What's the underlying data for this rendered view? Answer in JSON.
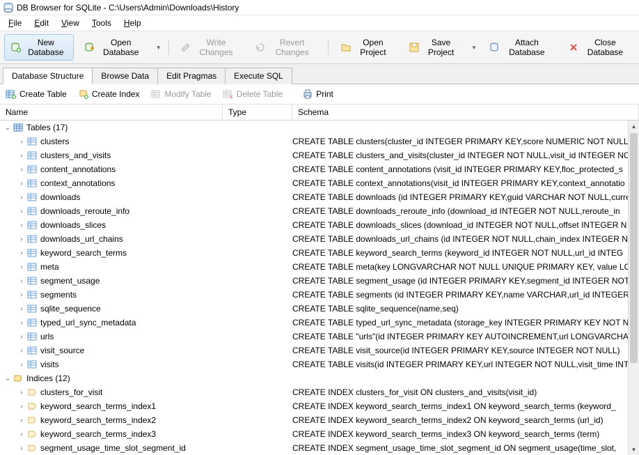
{
  "title": "DB Browser for SQLite - C:\\Users\\Admin\\Downloads\\History",
  "menubar": [
    "File",
    "Edit",
    "View",
    "Tools",
    "Help"
  ],
  "toolbar": {
    "new_db": "New Database",
    "open_db": "Open Database",
    "write_changes": "Write Changes",
    "revert_changes": "Revert Changes",
    "open_project": "Open Project",
    "save_project": "Save Project",
    "attach_db": "Attach Database",
    "close_db": "Close Database"
  },
  "tabs": [
    "Database Structure",
    "Browse Data",
    "Edit Pragmas",
    "Execute SQL"
  ],
  "active_tab": 0,
  "subtoolbar": {
    "create_table": "Create Table",
    "create_index": "Create Index",
    "modify_table": "Modify Table",
    "delete_table": "Delete Table",
    "print": "Print"
  },
  "columns": {
    "name": "Name",
    "type": "Type",
    "schema": "Schema"
  },
  "groups": [
    {
      "label": "Tables (17)",
      "kind": "table",
      "items": [
        {
          "name": "clusters",
          "schema": "CREATE TABLE clusters(cluster_id INTEGER PRIMARY KEY,score NUMERIC NOT NULL)"
        },
        {
          "name": "clusters_and_visits",
          "schema": "CREATE TABLE clusters_and_visits(cluster_id INTEGER NOT NULL,visit_id INTEGER NO"
        },
        {
          "name": "content_annotations",
          "schema": "CREATE TABLE content_annotations (visit_id INTEGER PRIMARY KEY,floc_protected_s"
        },
        {
          "name": "context_annotations",
          "schema": "CREATE TABLE context_annotations(visit_id INTEGER PRIMARY KEY,context_annotatio"
        },
        {
          "name": "downloads",
          "schema": "CREATE TABLE downloads (id INTEGER PRIMARY KEY,guid VARCHAR NOT NULL,curre"
        },
        {
          "name": "downloads_reroute_info",
          "schema": "CREATE TABLE downloads_reroute_info (download_id INTEGER NOT NULL,reroute_in"
        },
        {
          "name": "downloads_slices",
          "schema": "CREATE TABLE downloads_slices (download_id INTEGER NOT NULL,offset INTEGER N"
        },
        {
          "name": "downloads_url_chains",
          "schema": "CREATE TABLE downloads_url_chains (id INTEGER NOT NULL,chain_index INTEGER N"
        },
        {
          "name": "keyword_search_terms",
          "schema": "CREATE TABLE keyword_search_terms (keyword_id INTEGER NOT NULL,url_id INTEG"
        },
        {
          "name": "meta",
          "schema": "CREATE TABLE meta(key LONGVARCHAR NOT NULL UNIQUE PRIMARY KEY, value LON"
        },
        {
          "name": "segment_usage",
          "schema": "CREATE TABLE segment_usage (id INTEGER PRIMARY KEY,segment_id INTEGER NOT"
        },
        {
          "name": "segments",
          "schema": "CREATE TABLE segments (id INTEGER PRIMARY KEY,name VARCHAR,url_id INTEGER"
        },
        {
          "name": "sqlite_sequence",
          "schema": "CREATE TABLE sqlite_sequence(name,seq)"
        },
        {
          "name": "typed_url_sync_metadata",
          "schema": "CREATE TABLE typed_url_sync_metadata (storage_key INTEGER PRIMARY KEY NOT N"
        },
        {
          "name": "urls",
          "schema": "CREATE TABLE \"urls\"(id INTEGER PRIMARY KEY AUTOINCREMENT,url LONGVARCHAR,"
        },
        {
          "name": "visit_source",
          "schema": "CREATE TABLE visit_source(id INTEGER PRIMARY KEY,source INTEGER NOT NULL)"
        },
        {
          "name": "visits",
          "schema": "CREATE TABLE visits(id INTEGER PRIMARY KEY,url INTEGER NOT NULL,visit_time INTE"
        }
      ]
    },
    {
      "label": "Indices (12)",
      "kind": "index",
      "items": [
        {
          "name": "clusters_for_visit",
          "schema": "CREATE INDEX clusters_for_visit ON clusters_and_visits(visit_id)"
        },
        {
          "name": "keyword_search_terms_index1",
          "schema": "CREATE INDEX keyword_search_terms_index1 ON keyword_search_terms (keyword_"
        },
        {
          "name": "keyword_search_terms_index2",
          "schema": "CREATE INDEX keyword_search_terms_index2 ON keyword_search_terms (url_id)"
        },
        {
          "name": "keyword_search_terms_index3",
          "schema": "CREATE INDEX keyword_search_terms_index3 ON keyword_search_terms (term)"
        },
        {
          "name": "segment_usage_time_slot_segment_id",
          "schema": "CREATE INDEX segment_usage_time_slot_segment_id ON segment_usage(time_slot,"
        }
      ]
    }
  ]
}
